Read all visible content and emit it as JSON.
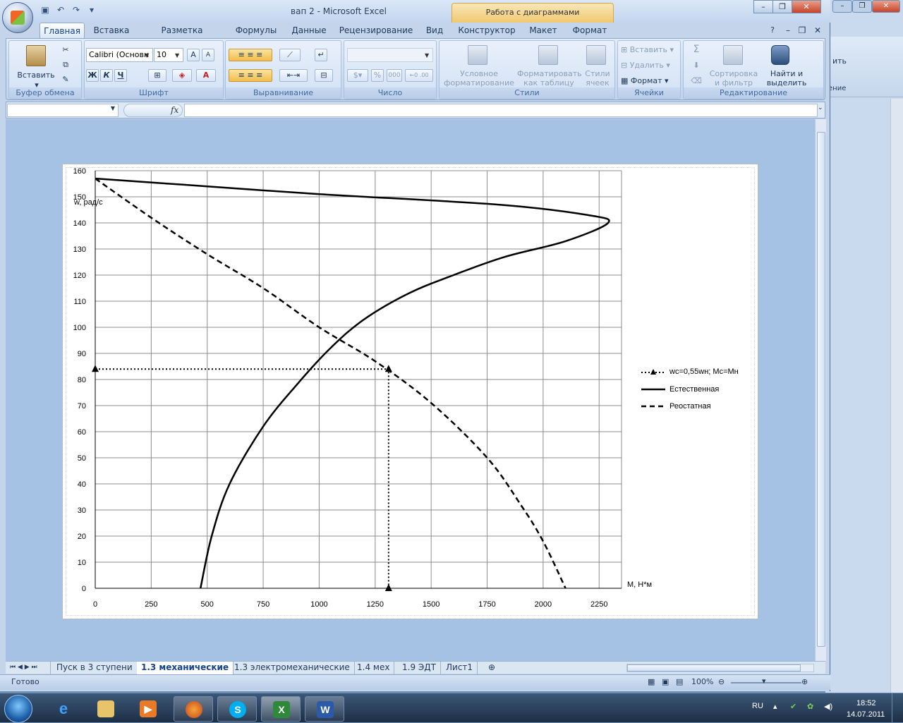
{
  "window": {
    "title": "вап 2 - Microsoft Excel",
    "context_tab": "Работа с диаграммами"
  },
  "tabs": [
    "Главная",
    "Вставка",
    "Разметка страницы",
    "Формулы",
    "Данные",
    "Рецензирование",
    "Вид",
    "Конструктор",
    "Макет",
    "Формат"
  ],
  "ribbon": {
    "clipboard": {
      "label": "Буфер обмена",
      "paste": "Вставить"
    },
    "font": {
      "label": "Шрифт",
      "font_name": "Calibri (Основн",
      "font_size": "10",
      "bold": "Ж",
      "italic": "К",
      "underline": "Ч"
    },
    "alignment": {
      "label": "Выравнивание"
    },
    "number": {
      "label": "Число",
      "percent": "%",
      "thousands": "000"
    },
    "styles": {
      "label": "Стили",
      "conditional": "Условное форматирование",
      "as_table": "Форматировать как таблицу",
      "cell_styles": "Стили ячеек"
    },
    "cells": {
      "label": "Ячейки",
      "insert": "Вставить",
      "delete": "Удалить",
      "format": "Формат"
    },
    "editing": {
      "label": "Редактирование",
      "sum": "Σ",
      "sort": "Сортировка и фильтр",
      "find": "Найти и выделить"
    }
  },
  "formula_bar": {
    "fx": "fx",
    "name": "",
    "value": ""
  },
  "chart_data": {
    "type": "line",
    "xlabel": "М, Н*м",
    "ylabel": "w, рад/с",
    "xlim": [
      0,
      2250
    ],
    "ylim": [
      0,
      160
    ],
    "x_ticks": [
      "0",
      "250",
      "500",
      "750",
      "1000",
      "1250",
      "1500",
      "1750",
      "2000",
      "2250"
    ],
    "y_ticks": [
      "0",
      "10",
      "20",
      "30",
      "40",
      "50",
      "60",
      "70",
      "80",
      "90",
      "100",
      "110",
      "120",
      "130",
      "140",
      "150",
      "160"
    ],
    "grid": true,
    "legend_position": "right",
    "series": [
      {
        "name": "wc=0,55wн; Mc=Mн",
        "style": "dotted-triangle",
        "x": [
          0,
          1310,
          1310
        ],
        "y": [
          84,
          84,
          0
        ]
      },
      {
        "name": "Естественная",
        "style": "solid",
        "x": [
          470,
          520,
          600,
          750,
          900,
          1050,
          1200,
          1400,
          1600,
          1830,
          2100,
          2290,
          2200,
          1800,
          1000,
          500,
          0
        ],
        "y": [
          0,
          20,
          40,
          62,
          78,
          92,
          103,
          113,
          120,
          127,
          133,
          140,
          143,
          147,
          151,
          154,
          157
        ]
      },
      {
        "name": "Реостатная",
        "style": "dashed",
        "x": [
          0,
          250,
          500,
          750,
          1000,
          1250,
          1500,
          1750,
          1900,
          2000,
          2100
        ],
        "y": [
          157,
          142,
          128,
          115,
          100,
          87,
          71,
          50,
          32,
          18,
          0
        ]
      }
    ]
  },
  "sheet_tabs": [
    "Пуск в 3 ступени",
    "1.3 механические",
    "1.3 электромеханические",
    "1.4 мех",
    "1.9 ЭДТ",
    "Лист1"
  ],
  "active_sheet": "1.3 механические",
  "status": {
    "ready": "Готово",
    "zoom": "100%"
  },
  "background_window": {
    "items": [
      "ить",
      "ение"
    ]
  },
  "taskbar": {
    "lang": "RU",
    "time": "18:52",
    "date": "14.07.2011"
  }
}
